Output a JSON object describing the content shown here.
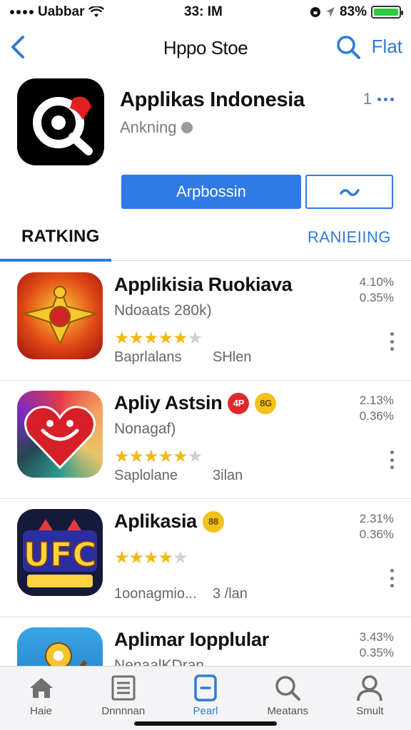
{
  "status_bar": {
    "carrier": "Uabbar",
    "time": "33: IM",
    "battery": "83%",
    "battery_level": 1.0
  },
  "nav": {
    "title": "Hppo Stoe",
    "right_label": "Flat",
    "back_icon": "chevron-left-icon",
    "search_icon": "search-icon"
  },
  "hero": {
    "name": "Applikas Indonesia",
    "subtitle": "Ankning",
    "rank": "1",
    "primary_button": "Arpbossin",
    "secondary_icon": "chevron-down-icon"
  },
  "tabs": [
    {
      "label": "RATKING",
      "active": true
    },
    {
      "label": "RANIEIING",
      "active": false
    }
  ],
  "apps": [
    {
      "name": "Applikisia Ruokiava",
      "desc": "Ndoaats 280k)",
      "rating": 4.5,
      "category": "Baprlalans",
      "size": "SHlen",
      "stat1": "4.10%",
      "stat2": "0.35%",
      "badges": []
    },
    {
      "name": "Apliy Astsin",
      "desc": "Nonagaf)",
      "rating": 4.5,
      "category": "Saplolane",
      "size": "3ilan",
      "stat1": "2.13%",
      "stat2": "0.36%",
      "badges": [
        {
          "text": "4P",
          "color": "red"
        },
        {
          "text": "8G",
          "color": "gold"
        }
      ]
    },
    {
      "name": "Aplikasia",
      "desc": "",
      "rating": 3.5,
      "category": "1oonagmio...",
      "size": "3 /lan",
      "stat1": "2.31%",
      "stat2": "0.36%",
      "badges": [
        {
          "text": "88",
          "color": "gold"
        }
      ]
    },
    {
      "name": "Aplimar Iopplular",
      "desc": "NenaalKDran",
      "rating": null,
      "category": "",
      "size": "",
      "stat1": "3.43%",
      "stat2": "0.35%",
      "badges": []
    }
  ],
  "tabbar": [
    {
      "label": "Haie",
      "icon": "home-icon",
      "active": false
    },
    {
      "label": "Dnnnnan",
      "icon": "list-icon",
      "active": false
    },
    {
      "label": "Pearl",
      "icon": "app-icon",
      "active": true
    },
    {
      "label": "Meatans",
      "icon": "search-icon",
      "active": false
    },
    {
      "label": "Smult",
      "icon": "person-icon",
      "active": false
    }
  ],
  "colors": {
    "accent": "#2e7bd6",
    "button": "#2f7ae5",
    "star": "#f3b814",
    "battery": "#2ecc40"
  }
}
